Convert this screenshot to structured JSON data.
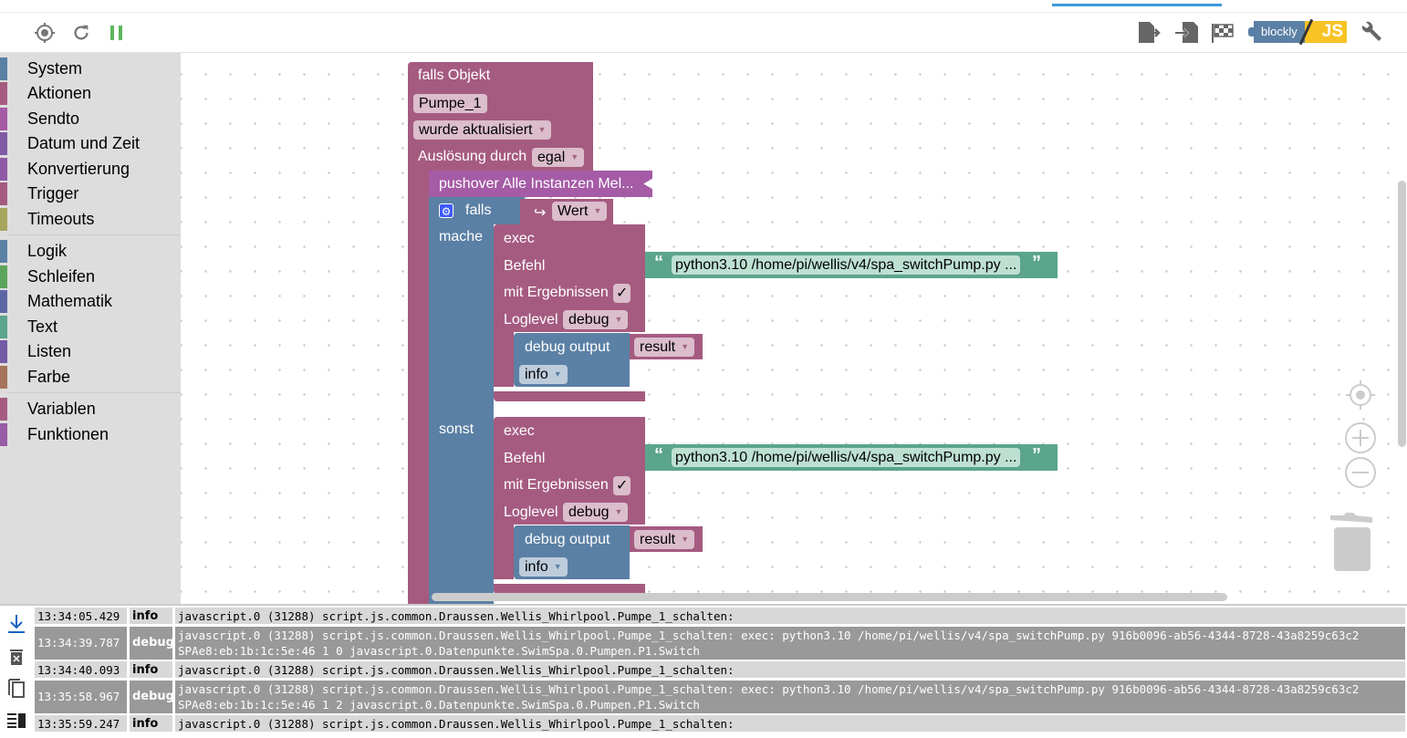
{
  "toolbar": {
    "left_icons": [
      "target-icon",
      "refresh-icon",
      "pause-icon"
    ],
    "right_icons": [
      "export-icon",
      "import-icon",
      "flag-icon",
      "blockly-js-toggle",
      "wrench-icon"
    ],
    "toggle_left": "blockly",
    "toggle_right": "JS",
    "pause_color": "#5cb85c"
  },
  "sidebar": {
    "groups": [
      [
        {
          "label": "System",
          "color": "#5b80a5"
        },
        {
          "label": "Aktionen",
          "color": "#a55b80"
        },
        {
          "label": "Sendto",
          "color": "#a55ba5"
        },
        {
          "label": "Datum und Zeit",
          "color": "#805ba5"
        },
        {
          "label": "Konvertierung",
          "color": "#8f5ba5"
        },
        {
          "label": "Trigger",
          "color": "#a55b80"
        },
        {
          "label": "Timeouts",
          "color": "#a5a55b"
        }
      ],
      [
        {
          "label": "Logik",
          "color": "#5b80a5"
        },
        {
          "label": "Schleifen",
          "color": "#5ba55b"
        },
        {
          "label": "Mathematik",
          "color": "#5b67a5"
        },
        {
          "label": "Text",
          "color": "#5ba58c"
        },
        {
          "label": "Listen",
          "color": "#745ba5"
        },
        {
          "label": "Farbe",
          "color": "#a5745b"
        }
      ],
      [
        {
          "label": "Variablen",
          "color": "#a55b80"
        },
        {
          "label": "Funktionen",
          "color": "#995ba5"
        }
      ]
    ]
  },
  "blocks": {
    "trigger": {
      "title": "falls Objekt",
      "object": "Pumpe_1",
      "condition": "wurde aktualisiert",
      "ack_label": "Auslösung durch",
      "ack_value": "egal"
    },
    "pushover": {
      "label": "pushover Alle Instanzen Mel..."
    },
    "if": {
      "label": "falls",
      "then": "mache",
      "else": "sonst",
      "value_arrow": "↪",
      "value": "Wert"
    },
    "exec": [
      {
        "title": "exec",
        "command_label": "Befehl",
        "command": "python3.10 /home/pi/wellis/v4/spa_switchPump.py ...",
        "results_label": "mit Ergebnissen",
        "results_checked": "✓",
        "loglevel_label": "Loglevel",
        "loglevel": "debug",
        "debug_label": "debug output",
        "debug_var": "result",
        "debug_level": "info"
      },
      {
        "title": "exec",
        "command_label": "Befehl",
        "command": "python3.10 /home/pi/wellis/v4/spa_switchPump.py ...",
        "results_label": "mit Ergebnissen",
        "results_checked": "✓",
        "loglevel_label": "Loglevel",
        "loglevel": "debug",
        "debug_label": "debug output",
        "debug_var": "result",
        "debug_level": "info"
      }
    ],
    "quote_open": "“",
    "quote_close": "”"
  },
  "workspace_controls": [
    "recenter-icon",
    "zoom-in-icon",
    "zoom-out-icon",
    "trash-icon"
  ],
  "log": {
    "icons": [
      "scroll-down-icon",
      "delete-icon",
      "copy-icon",
      "columns-icon"
    ],
    "rows": [
      {
        "time": "13:34:05.429",
        "level": "info",
        "message": "javascript.0 (31288) script.js.common.Draussen.Wellis_Whirlpool.Pumpe_1_schalten:"
      },
      {
        "time": "13:34:39.787",
        "level": "debug",
        "message": "javascript.0 (31288) script.js.common.Draussen.Wellis_Whirlpool.Pumpe_1_schalten: exec: python3.10 /home/pi/wellis/v4/spa_switchPump.py 916b0096-ab56-4344-8728-43a8259c63c2 SPAe8:eb:1b:1c:5e:46 1 0 javascript.0.Datenpunkte.SwimSpa.0.Pumpen.P1.Switch"
      },
      {
        "time": "13:34:40.093",
        "level": "info",
        "message": "javascript.0 (31288) script.js.common.Draussen.Wellis_Whirlpool.Pumpe_1_schalten:"
      },
      {
        "time": "13:35:58.967",
        "level": "debug",
        "message": "javascript.0 (31288) script.js.common.Draussen.Wellis_Whirlpool.Pumpe_1_schalten: exec: python3.10 /home/pi/wellis/v4/spa_switchPump.py 916b0096-ab56-4344-8728-43a8259c63c2 SPAe8:eb:1b:1c:5e:46 1 2 javascript.0.Datenpunkte.SwimSpa.0.Pumpen.P1.Switch"
      },
      {
        "time": "13:35:59.247",
        "level": "info",
        "message": "javascript.0 (31288) script.js.common.Draussen.Wellis_Whirlpool.Pumpe_1_schalten:"
      }
    ]
  }
}
